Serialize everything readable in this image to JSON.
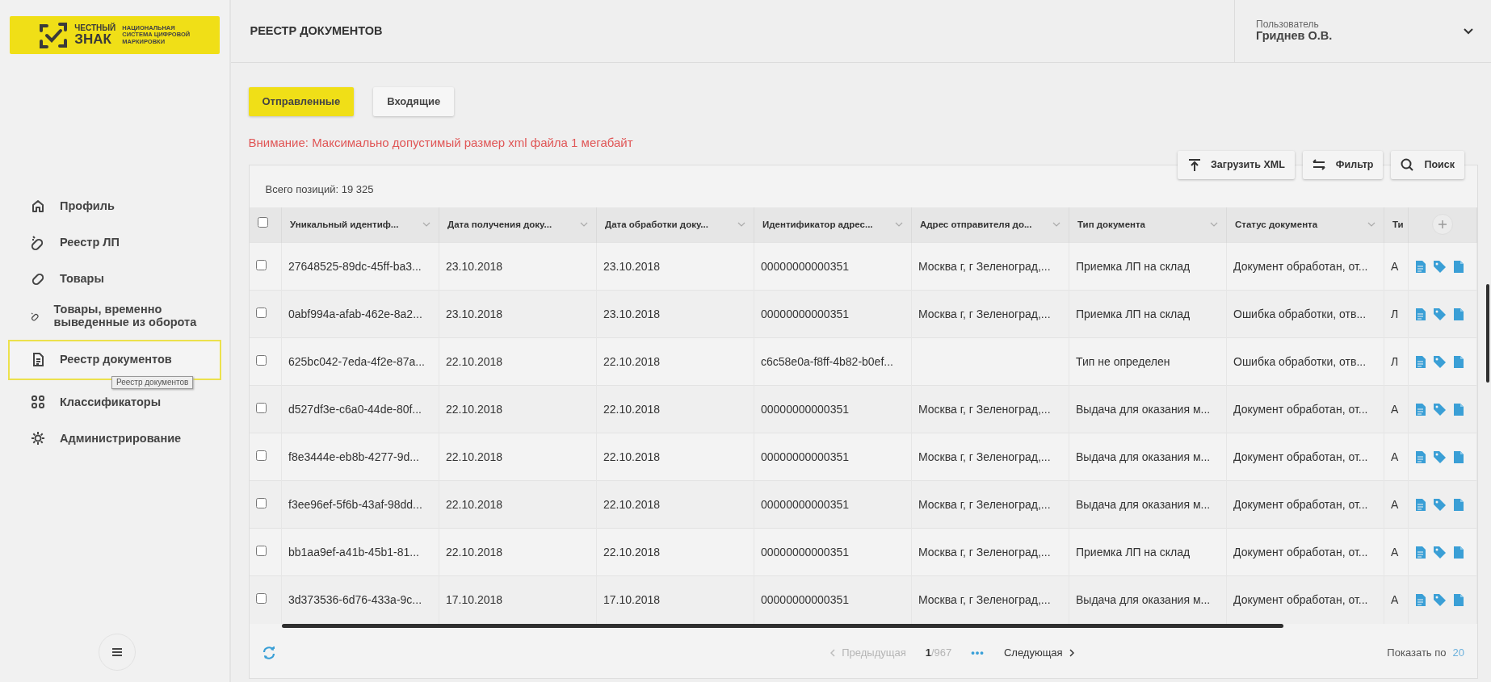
{
  "sidebar": {
    "logo": {
      "brand_top": "ЧЕСТНЫЙ",
      "brand_bottom": "ЗНАК",
      "tagline": [
        "НАЦИОНАЛЬНАЯ",
        "СИСТЕМА ЦИФРОВОЙ",
        "МАРКИРОВКИ"
      ]
    },
    "items": [
      {
        "label": "Профиль",
        "selected": false
      },
      {
        "label": "Реестр ЛП",
        "selected": false
      },
      {
        "label": "Товары",
        "selected": false
      },
      {
        "label": "Товары, временно выведенные из оборота",
        "selected": false
      },
      {
        "label": "Реестр документов",
        "selected": true
      },
      {
        "label": "Классификаторы",
        "selected": false
      },
      {
        "label": "Администрирование",
        "selected": false
      }
    ],
    "tooltip": "Реестр документов"
  },
  "header": {
    "title": "РЕЕСТР ДОКУМЕНТОВ",
    "user_label": "Пользователь",
    "user_name": "Гриднев О.В."
  },
  "tabs": [
    {
      "label": "Отправленные",
      "selected": true
    },
    {
      "label": "Входящие",
      "selected": false
    }
  ],
  "warning": "Внимание: Максимально допустимый размер xml файла 1 мегабайт",
  "toolbar": [
    {
      "label": "Загрузить XML"
    },
    {
      "label": "Фильтр"
    },
    {
      "label": "Поиск"
    }
  ],
  "table": {
    "total": "Всего позиций: 19 325",
    "select_all_checked": false,
    "columns": [
      "Уникальный идентиф...",
      "Дата получения доку...",
      "Дата обработки доку...",
      "Идентификатор адрес...",
      "Адрес отправителя до...",
      "Тип документа",
      "Статус документа",
      "Ти"
    ],
    "rows": [
      {
        "checked": false,
        "cells": [
          "27648525-89dc-45ff-ba3...",
          "23.10.2018",
          "23.10.2018",
          "00000000000351",
          "Москва г, г Зеленоград,...",
          "Приемка ЛП на склад",
          "Документ обработан, от...",
          "А"
        ]
      },
      {
        "checked": false,
        "cells": [
          "0abf994a-afab-462e-8a2...",
          "23.10.2018",
          "23.10.2018",
          "00000000000351",
          "Москва г, г Зеленоград,...",
          "Приемка ЛП на склад",
          "Ошибка обработки, отв...",
          "Л"
        ]
      },
      {
        "checked": false,
        "cells": [
          "625bc042-7eda-4f2e-87a...",
          "22.10.2018",
          "22.10.2018",
          "c6c58e0a-f8ff-4b82-b0ef...",
          null,
          "Тип не определен",
          "Ошибка обработки, отв...",
          "Л"
        ]
      },
      {
        "checked": false,
        "cells": [
          "d527df3e-c6a0-44de-80f...",
          "22.10.2018",
          "22.10.2018",
          "00000000000351",
          "Москва г, г Зеленоград,...",
          "Выдача для оказания м...",
          "Документ обработан, от...",
          "А"
        ]
      },
      {
        "checked": false,
        "cells": [
          "f8e3444e-eb8b-4277-9d...",
          "22.10.2018",
          "22.10.2018",
          "00000000000351",
          "Москва г, г Зеленоград,...",
          "Выдача для оказания м...",
          "Документ обработан, от...",
          "А"
        ]
      },
      {
        "checked": false,
        "cells": [
          "f3ee96ef-5f6b-43af-98dd...",
          "22.10.2018",
          "22.10.2018",
          "00000000000351",
          "Москва г, г Зеленоград,...",
          "Выдача для оказания м...",
          "Документ обработан, от...",
          "А"
        ]
      },
      {
        "checked": false,
        "cells": [
          "bb1aa9ef-a41b-45b1-81...",
          "22.10.2018",
          "22.10.2018",
          "00000000000351",
          "Москва г, г Зеленоград,...",
          "Приемка ЛП на склад",
          "Документ обработан, от...",
          "А"
        ]
      },
      {
        "checked": false,
        "cells": [
          "3d373536-6d76-433a-9c...",
          "17.10.2018",
          "17.10.2018",
          "00000000000351",
          "Москва г, г Зеленоград,...",
          "Выдача для оказания м...",
          "Документ обработан, от...",
          "А"
        ]
      }
    ]
  },
  "pagination": {
    "previous": "Предыдущая",
    "previous_disabled": true,
    "current": "1",
    "total": "/967",
    "more": "•••",
    "next": "Следующая",
    "page_size_label": "Показать по",
    "page_size": "20"
  }
}
